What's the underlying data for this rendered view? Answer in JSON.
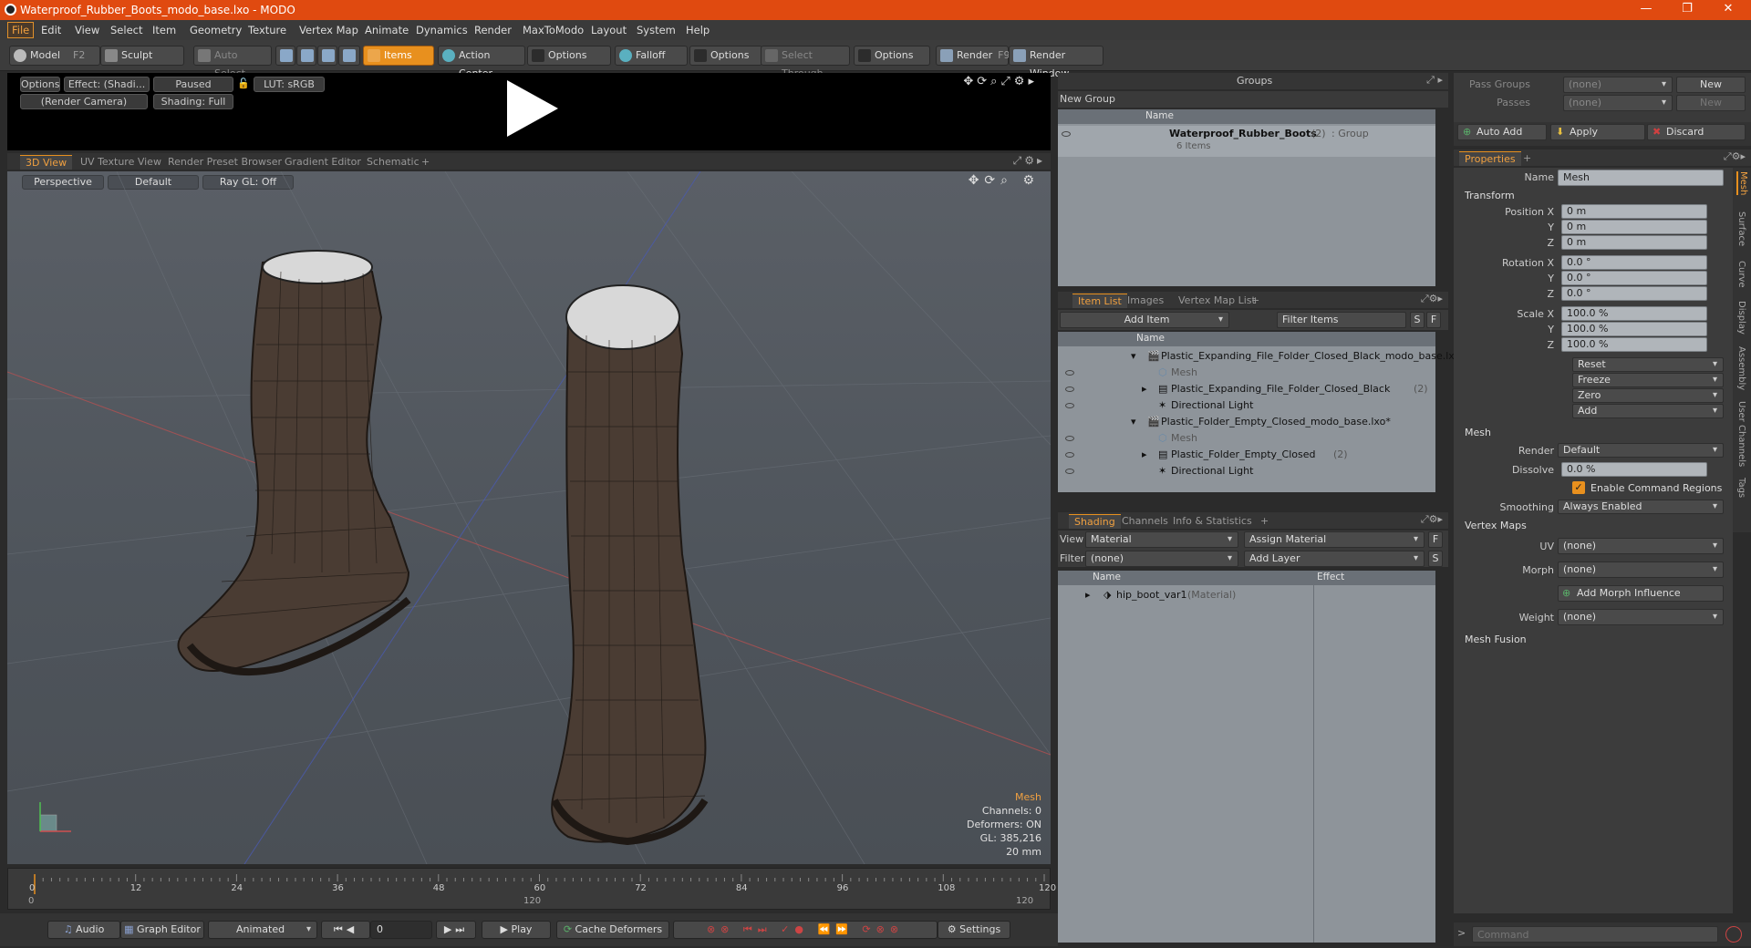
{
  "window": {
    "title": "Waterproof_Rubber_Boots_modo_base.lxo - MODO"
  },
  "menu": [
    "File",
    "Edit",
    "View",
    "Select",
    "Item",
    "Geometry",
    "Texture",
    "Vertex Map",
    "Animate",
    "Dynamics",
    "Render",
    "MaxToModo",
    "Layout",
    "System",
    "Help"
  ],
  "toolbar": {
    "model": "Model",
    "model_key": "F2",
    "sculpt": "Sculpt",
    "auto_select": "Auto Select",
    "items": "Items",
    "action_center": "Action Center",
    "options1": "Options",
    "falloff": "Falloff",
    "options2": "Options",
    "select_through": "Select Through",
    "options3": "Options",
    "render": "Render",
    "render_key": "F9",
    "render_window": "Render Window"
  },
  "preview": {
    "options": "Options",
    "effect": "Effect: (Shadi...",
    "paused": "Paused",
    "lut": "LUT: sRGB",
    "camera": "(Render Camera)",
    "shading": "Shading: Full"
  },
  "viewport_tabs": [
    "3D View",
    "UV Texture View",
    "Render Preset Browser",
    "Gradient Editor",
    "Schematic",
    "+"
  ],
  "viewport": {
    "projection": "Perspective",
    "style": "Default",
    "raygl": "Ray GL: Off",
    "info_title": "Mesh",
    "channels": "Channels: 0",
    "deformers": "Deformers: ON",
    "gl": "GL: 385,216",
    "scale": "20 mm"
  },
  "timeline": {
    "ticks": [
      "0",
      "12",
      "24",
      "36",
      "48",
      "60",
      "72",
      "84",
      "96",
      "108",
      "120"
    ],
    "start": "0",
    "mid": "120",
    "end": "120"
  },
  "transport": {
    "audio": "Audio",
    "graph_editor": "Graph Editor",
    "animated": "Animated",
    "frame": "0",
    "play": "Play",
    "cache": "Cache Deformers",
    "settings": "Settings"
  },
  "groups": {
    "title": "Groups",
    "new_group": "New Group",
    "col_name": "Name",
    "item_name": "Waterproof_Rubber_Boots",
    "item_count": "(2)",
    "item_type": ": Group",
    "item_sub": "6 Items"
  },
  "passes": {
    "pass_groups": "Pass Groups",
    "passes": "Passes",
    "none1": "(none)",
    "none2": "(none)",
    "new1": "New",
    "new2": "New"
  },
  "actions": {
    "auto_add": "Auto Add",
    "apply": "Apply",
    "discard": "Discard"
  },
  "itemlist": {
    "tabs": [
      "Item List",
      "Images",
      "Vertex Map List",
      "+"
    ],
    "add_item": "Add Item",
    "filter": "Filter Items",
    "s": "S",
    "f": "F",
    "col_name": "Name",
    "rows": [
      {
        "text": "Plastic_Expanding_File_Folder_Closed_Black_modo_base.lxo",
        "extra": ""
      },
      {
        "text": "Mesh",
        "extra": ""
      },
      {
        "text": "Plastic_Expanding_File_Folder_Closed_Black",
        "extra": "(2)"
      },
      {
        "text": "Directional Light",
        "extra": ""
      },
      {
        "text": "Plastic_Folder_Empty_Closed_modo_base.lxo*",
        "extra": ""
      },
      {
        "text": "Mesh",
        "extra": ""
      },
      {
        "text": "Plastic_Folder_Empty_Closed",
        "extra": "(2)"
      },
      {
        "text": "Directional Light",
        "extra": ""
      }
    ]
  },
  "shading": {
    "tabs": [
      "Shading",
      "Channels",
      "Info & Statistics",
      "+"
    ],
    "view_lbl": "View",
    "view_val": "Material",
    "assign": "Assign Material",
    "f": "F",
    "filter_lbl": "Filter",
    "filter_val": "(none)",
    "add_layer": "Add Layer",
    "s": "S",
    "col_name": "Name",
    "col_effect": "Effect",
    "row_name": "hip_boot_var1",
    "row_type": "(Material)"
  },
  "properties": {
    "tab": "Properties",
    "plus": "+",
    "name_lbl": "Name",
    "name_val": "Mesh",
    "transform": "Transform",
    "pos_lbl": "Position X",
    "y": "Y",
    "z": "Z",
    "pos": [
      "0 m",
      "0 m",
      "0 m"
    ],
    "rot_lbl": "Rotation X",
    "rot": [
      "0.0 °",
      "0.0 °",
      "0.0 °"
    ],
    "scale_lbl": "Scale X",
    "scale": [
      "100.0 %",
      "100.0 %",
      "100.0 %"
    ],
    "reset": "Reset",
    "freeze": "Freeze",
    "zero": "Zero",
    "add": "Add",
    "mesh": "Mesh",
    "render_lbl": "Render",
    "render_val": "Default",
    "dissolve_lbl": "Dissolve",
    "dissolve_val": "0.0 %",
    "enable_cmd": "Enable Command Regions",
    "smoothing_lbl": "Smoothing",
    "smoothing_val": "Always Enabled",
    "vertex_maps": "Vertex Maps",
    "uv_lbl": "UV",
    "uv_val": "(none)",
    "morph_lbl": "Morph",
    "morph_val": "(none)",
    "add_morph": "Add Morph Influence",
    "weight_lbl": "Weight",
    "weight_val": "(none)",
    "mesh_fusion": "Mesh Fusion",
    "side_tabs": [
      "Mesh",
      "Surface",
      "Curve",
      "Display",
      "Assembly",
      "User Channels",
      "Tags"
    ]
  },
  "command": {
    "placeholder": "Command"
  },
  "colors": {
    "accent": "#e8901e",
    "titlebar": "#e04a10"
  }
}
